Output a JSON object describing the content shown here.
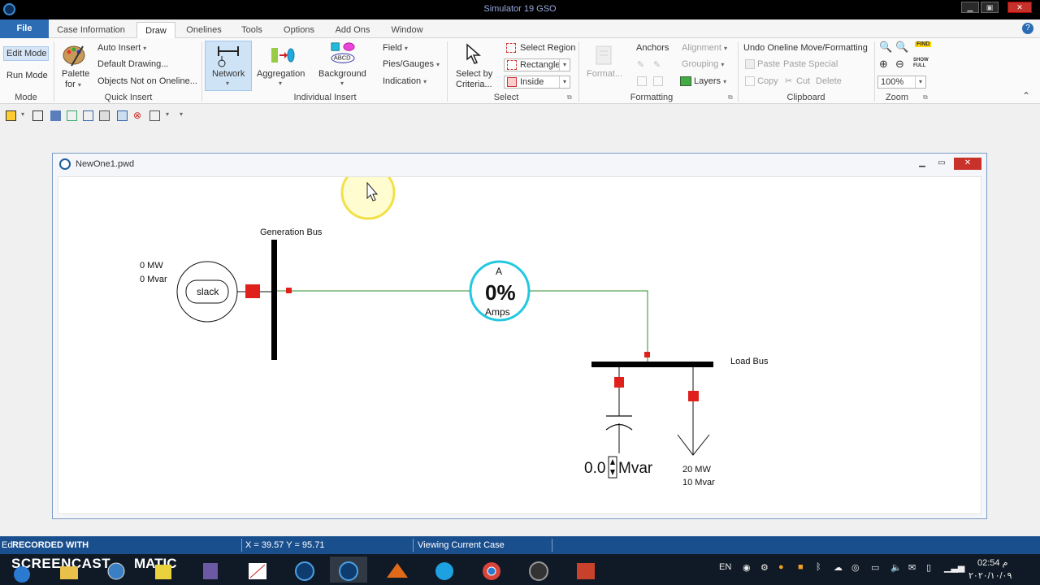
{
  "app": {
    "title": "Simulator 19 GSO"
  },
  "tabs": [
    {
      "label": "File"
    },
    {
      "label": "Case Information"
    },
    {
      "label": "Draw"
    },
    {
      "label": "Onelines"
    },
    {
      "label": "Tools"
    },
    {
      "label": "Options"
    },
    {
      "label": "Add Ons"
    },
    {
      "label": "Window"
    }
  ],
  "ribbon": {
    "mode": {
      "edit": "Edit Mode",
      "run": "Run Mode",
      "group": "Mode"
    },
    "quick_insert": {
      "palette_line1": "Palette",
      "palette_line2": "for",
      "auto_insert": "Auto Insert",
      "default_drawing": "Default Drawing...",
      "objects_not_on_oneline": "Objects Not on Oneline...",
      "group": "Quick Insert"
    },
    "individual_insert": {
      "network": "Network",
      "aggregation": "Aggregation",
      "background": "Background",
      "background_icon_text": "ABCD",
      "field": "Field",
      "pies_gauges": "Pies/Gauges",
      "indication": "Indication",
      "group": "Individual Insert"
    },
    "select": {
      "select_by_line1": "Select by",
      "select_by_line2": "Criteria...",
      "select_region": "Select Region",
      "rectangle": "Rectangle",
      "inside": "Inside",
      "group": "Select"
    },
    "formatting": {
      "format": "Format...",
      "anchors": "Anchors",
      "alignment": "Alignment",
      "grouping": "Grouping",
      "layers": "Layers",
      "group": "Formatting"
    },
    "clipboard": {
      "undo": "Undo Oneline Move/Formatting",
      "paste": "Paste",
      "paste_special": "Paste Special",
      "copy": "Copy",
      "cut": "Cut",
      "delete": "Delete",
      "group": "Clipboard"
    },
    "zoom": {
      "level": "100%",
      "group": "Zoom",
      "find": "FIND",
      "show_full": "SHOW FULL"
    }
  },
  "document": {
    "title": "NewOne1.pwd"
  },
  "oneline": {
    "gen_bus_label": "Generation Bus",
    "load_bus_label": "Load Bus",
    "gen_mw": "0 MW",
    "gen_mvar": "0 Mvar",
    "slack_label": "slack",
    "flow_top": "A",
    "flow_pct": "0%",
    "flow_unit": "Amps",
    "cap_value": "0.0",
    "cap_unit": "Mvar",
    "load_mw": "20 MW",
    "load_mvar": "10 Mvar"
  },
  "statusbar": {
    "coords": "X = 39.57 Y = 95.71",
    "status": "Viewing Current Case",
    "mode_abbrev": "Edi"
  },
  "watermark": {
    "line1": "RECORDED WITH",
    "line2": "SCREENCAST",
    "line3": "MATIC"
  },
  "tray": {
    "lang": "EN",
    "time": "02:54 م",
    "date": "٢٠٢٠/١٠/٠٩"
  },
  "colors": {
    "accent": "#2b6cb5",
    "line_green": "#2e8b2e",
    "breaker_red": "#e0201b",
    "flow_cyan": "#22c8e0",
    "statusbar": "#1a4f8e"
  }
}
